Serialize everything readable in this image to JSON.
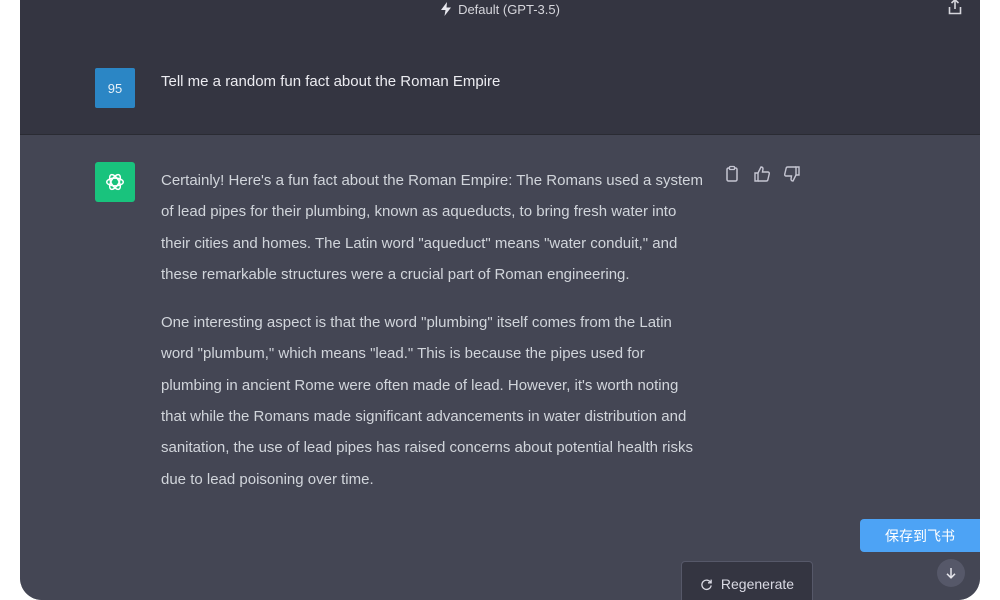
{
  "header": {
    "model_label": "Default (GPT-3.5)",
    "share_icon": "share-icon",
    "bolt_icon": "bolt-icon"
  },
  "user_message": {
    "avatar_text": "95",
    "avatar_color": "#2b86c5",
    "text": "Tell me a random fun fact about the Roman Empire"
  },
  "assistant_message": {
    "avatar_icon": "openai-logo-icon",
    "avatar_color": "#19c37d",
    "paragraphs": [
      "Certainly! Here's a fun fact about the Roman Empire: The Romans used a system of lead pipes for their plumbing, known as aqueducts, to bring fresh water into their cities and homes. The Latin word \"aqueduct\" means \"water conduit,\" and these remarkable structures were a crucial part of Roman engineering.",
      "One interesting aspect is that the word \"plumbing\" itself comes from the Latin word \"plumbum,\" which means \"lead.\" This is because the pipes used for plumbing in ancient Rome were often made of lead. However, it's worth noting that while the Romans made significant advancements in water distribution and sanitation, the use of lead pipes has raised concerns about potential health risks due to lead poisoning over time."
    ],
    "actions": [
      "copy-icon",
      "thumbs-up-icon",
      "thumbs-down-icon"
    ]
  },
  "controls": {
    "regenerate_label": "Regenerate",
    "save_badge_label": "保存到飞书",
    "scroll_down_icon": "arrow-down-icon"
  },
  "colors": {
    "background": "#343541",
    "assistant_background": "#444654",
    "accent_badge": "#4da3f5"
  }
}
